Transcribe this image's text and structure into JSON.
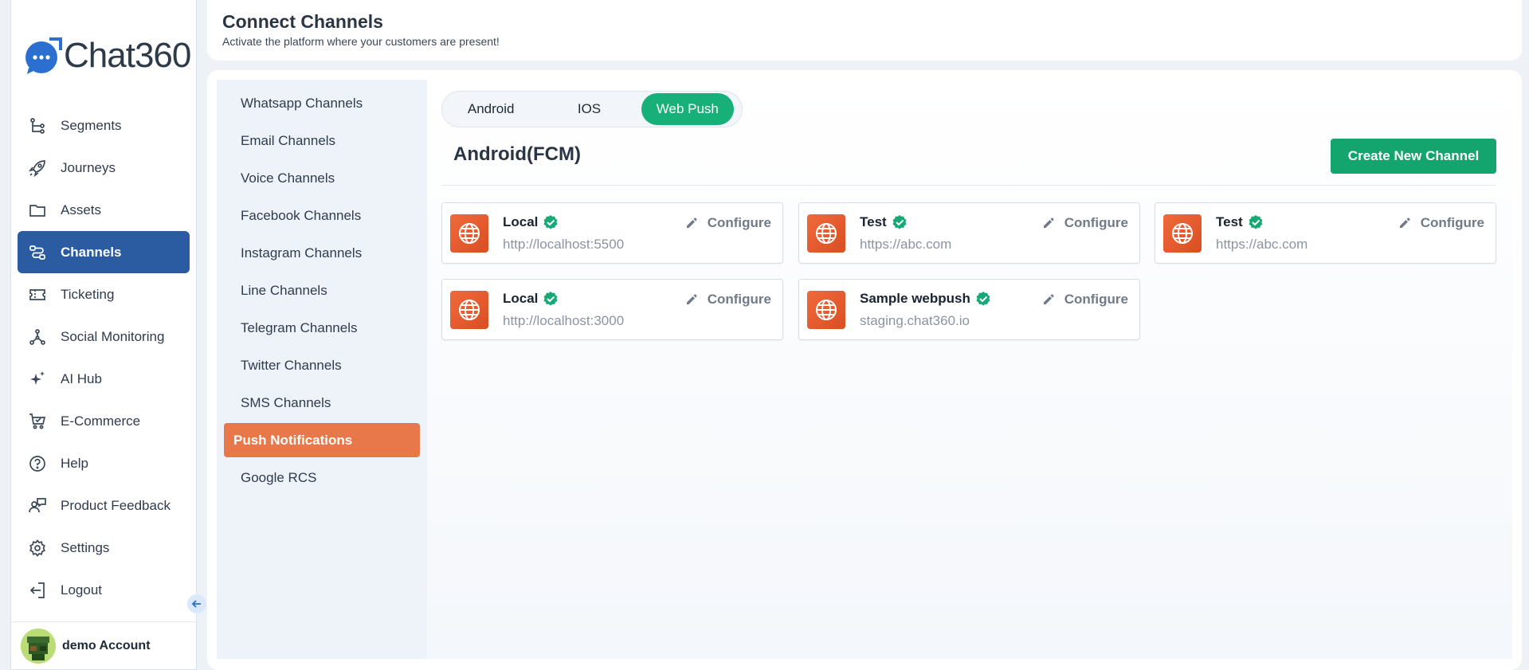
{
  "brand": {
    "name": "Chat360"
  },
  "sidebar": {
    "items": [
      {
        "label": "Segments",
        "icon": "segments-icon"
      },
      {
        "label": "Journeys",
        "icon": "rocket-icon"
      },
      {
        "label": "Assets",
        "icon": "folder-icon"
      },
      {
        "label": "Channels",
        "icon": "channels-icon",
        "active": true
      },
      {
        "label": "Ticketing",
        "icon": "ticket-icon"
      },
      {
        "label": "Social Monitoring",
        "icon": "network-icon"
      },
      {
        "label": "AI Hub",
        "icon": "sparkle-icon"
      },
      {
        "label": "E-Commerce",
        "icon": "cart-icon"
      },
      {
        "label": "Help",
        "icon": "help-icon"
      },
      {
        "label": "Product Feedback",
        "icon": "feedback-icon"
      },
      {
        "label": "Settings",
        "icon": "gear-icon"
      },
      {
        "label": "Logout",
        "icon": "logout-icon"
      }
    ],
    "account": {
      "name": "demo Account"
    }
  },
  "header": {
    "title": "Connect Channels",
    "subtitle": "Activate the platform where your customers are present!"
  },
  "channels": {
    "items": [
      "Whatsapp Channels",
      "Email Channels",
      "Voice Channels",
      "Facebook Channels",
      "Instagram Channels",
      "Line Channels",
      "Telegram Channels",
      "Twitter Channels",
      "SMS Channels",
      "Push Notifications",
      "Google RCS"
    ],
    "active": "Push Notifications"
  },
  "tabs": {
    "items": [
      "Android",
      "IOS",
      "Web Push"
    ],
    "active": "Web Push"
  },
  "section": {
    "title": "Android(FCM)",
    "create_label": "Create New Channel",
    "configure_label": "Configure"
  },
  "cards": [
    {
      "name": "Local",
      "url": "http://localhost:5500"
    },
    {
      "name": "Test",
      "url": "https://abc.com"
    },
    {
      "name": "Test",
      "url": "https://abc.com"
    },
    {
      "name": "Local",
      "url": "http://localhost:3000"
    },
    {
      "name": "Sample webpush",
      "url": "staging.chat360.io"
    }
  ],
  "colors": {
    "sidebar_active": "#2b5ba1",
    "channel_active": "#e8784a",
    "accent_green": "#13a56d",
    "card_icon": "#e65a2f"
  }
}
